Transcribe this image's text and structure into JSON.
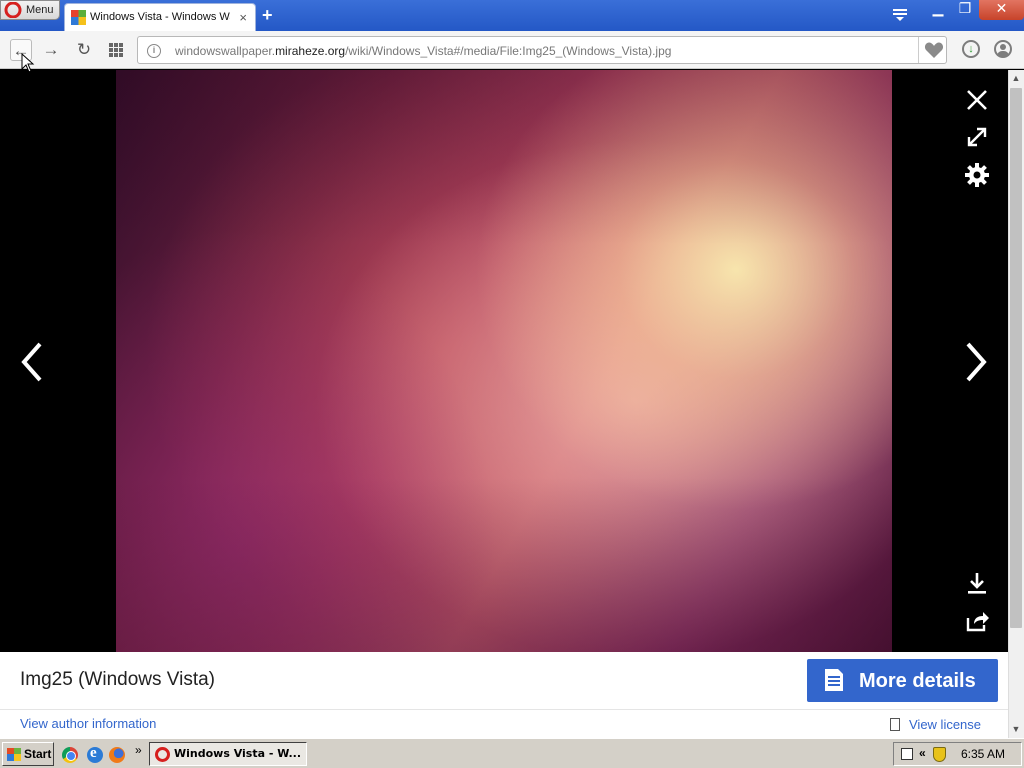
{
  "browser": {
    "menu_label": "Menu",
    "tab_title": "Windows Vista - Windows Wallpaper",
    "tab_close": "×",
    "new_tab": "+",
    "window_minimize": "▁",
    "window_restore": "❐",
    "window_close": "✕"
  },
  "address_bar": {
    "url_prefix": "windowswallpaper.",
    "url_domain": "miraheze.org",
    "url_path": "/wiki/Windows_Vista#/media/File:Img25_(Windows_Vista).jpg",
    "info_icon": "i"
  },
  "nav": {
    "back": "←",
    "forward": "→",
    "reload": "↻",
    "speed_dial": "⋮⋮"
  },
  "viewer": {
    "image_title": "Img25 (Windows Vista)",
    "more_details_label": "More details",
    "author_link": "View author information",
    "license_link": "View license"
  },
  "colors": {
    "accent_blue": "#3366cc",
    "titlebar_blue": "#2458c6",
    "close_red": "#c7432a"
  },
  "taskbar": {
    "start_label": "Start",
    "more_quicklaunch": "»",
    "task_label": "Windows Vista - W...",
    "tray_chevron": "«",
    "clock": "6:35 AM"
  }
}
